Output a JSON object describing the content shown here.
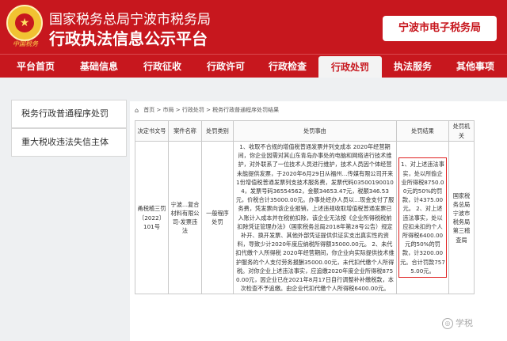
{
  "header": {
    "logo_text": "中国税务",
    "title_line1": "国家税务总局宁波市税务局",
    "title_line2": "行政执法信息公示平台",
    "e_tax_button": "宁波市电子税务局"
  },
  "nav": {
    "items": [
      "平台首页",
      "基础信息",
      "行政征收",
      "行政许可",
      "行政检查",
      "行政处罚",
      "执法服务",
      "其他事项"
    ],
    "active": "行政处罚"
  },
  "sidebar": {
    "items": [
      "税务行政普通程序处罚",
      "重大税收违法失信主体"
    ]
  },
  "breadcrumb": {
    "text": "首页 > 市局 > 行政处罚 > 税务行政普通程序处罚结果"
  },
  "table": {
    "headers": [
      "决定书文号",
      "案件名称",
      "处罚类别",
      "处罚事由",
      "处罚结果",
      "处罚机关"
    ],
    "row": {
      "doc_number": "甬税稽三罚〔2022〕101号",
      "case_name": "宁波…复合材料有限公司-发票违法",
      "penalty_type": "一般程序处罚",
      "reason": "1、收取不合规的增值税普通发票并列支成本 2020年经营期间，你企业因需对其山东青岛办事处的电脑和网络进行技术维护，对外联系了一位技术人员进行维护，技术人员因个体经营未能提供发票，于2020年6月29日从福州…传媒有限公司开来1份增值税普通发票列支技术服务费，发票代码035001900104，发票号码36554562，金额34653.47元，税额346.53元，价税合计35000.00元。办事处经办人员以…现金支付了服务费，凭发票向该企业报销，上述违规收取增值税普通发票已入账计入成本并在税前扣除，该企业无法按《企业所得税税前扣除凭证管理办法》（国家税务总局2018年第28号公告）规定补开、换开发票、其他外部凭证提供供证实支出真实性的资料，导致少计2020年度应纳税所得额35000.00元。 2、未代扣代缴个人所得税 2020年经营期间，你企业向实际提供技术维护服务的个人支付劳务报酬35000.00元，未代扣代缴个人所得税。对你企业上述违法事实，应追缴2020年度企业所得税8750.00元，因企业已在2021年8月17日自行调整补补缴税款，本次检查不予追缴。由企业代扣代缴个人所得税6400.00元。",
      "result": "1、对上述违法事实，处以所偷企业所得税8750.00元的50%的罚款，计4375.00元。 2、对上述违法事实，处以应扣未扣的个人所得税6400.00元的50%的罚款，计3200.00元。合计罚款7575.00元。",
      "authority": "国家税务总局宁波市税务局第三稽查局"
    }
  },
  "watermark": {
    "text": "学税"
  },
  "colors": {
    "brand_red": "#c7171e",
    "highlight_red": "#e02020"
  }
}
